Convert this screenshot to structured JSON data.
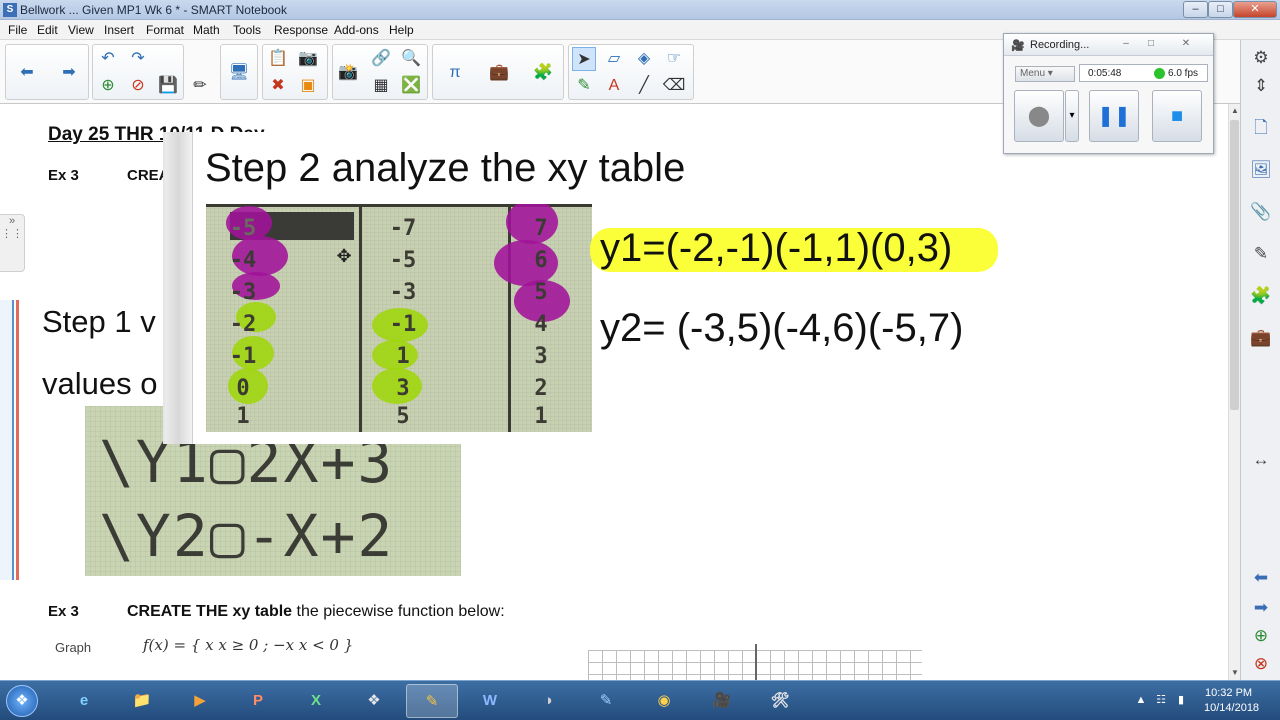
{
  "window": {
    "title": "Bellwork ... Given MP1 Wk 6 * - SMART Notebook",
    "minimize": "–",
    "maximize": "□",
    "close": "✕"
  },
  "menu": [
    "File",
    "Edit",
    "View",
    "Insert",
    "Format",
    "Math",
    "Tools",
    "Response",
    "Add-ons",
    "Help"
  ],
  "toolbar": {
    "icons": [
      "back-arrow-icon",
      "forward-arrow-icon",
      "undo-icon",
      "redo-icon",
      "add-page-icon",
      "delete-page-icon",
      "save-icon",
      "pen-icon",
      "screen-shade-icon",
      "paste-icon",
      "screen-capture-icon",
      "delete-icon",
      "table-icon",
      "object-icon",
      "pi-math-icon",
      "gallery-icon",
      "puzzle-icon",
      "select-icon",
      "fill-icon",
      "eraser-icon",
      "pens-icon",
      "text-icon",
      "line-icon",
      "magic-pen-icon"
    ]
  },
  "canvas": {
    "day_heading": "Day 25 THR 10/11   D Day",
    "ex3_label": "Ex 3",
    "ex3_create_prefix": "CREA",
    "step1_line1": "Step 1 v",
    "step1_line2": "values o",
    "calc_eq1": "\\Y1▢2X+3",
    "calc_eq2": "\\Y2▢-X+2",
    "step2_title": "Step 2 analyze the xy table",
    "y1_text": "y1=(-2,-1)(-1,1)(0,3)",
    "y2_text": "y2= (-3,5)(-4,6)(-5,7)",
    "ex3_bottom_label": "Ex 3",
    "ex3_bottom_bold": "CREATE THE  xy table",
    "ex3_bottom_rest": " the piecewise function below:",
    "graph_label": "Graph",
    "fx_text": "f(x) = { x   x ≥ 0 ; −x   x < 0 }"
  },
  "calc_table": {
    "x_col": [
      "-5",
      "-4",
      "-3",
      "-2",
      "-1",
      "0",
      "1"
    ],
    "y1_col": [
      "-7",
      "-5",
      "-3",
      "-1",
      "1",
      "3",
      "5"
    ],
    "y2_col": [
      "7",
      "6",
      "5",
      "4",
      "3",
      "2",
      "1"
    ],
    "highlight_purple": "#a0129a",
    "highlight_green": "#9ed60a"
  },
  "recorder": {
    "title": "Recording...",
    "menu_label": "Menu",
    "elapsed": "0:05:48",
    "fps": "6.0 fps",
    "status_color": "#2cc22c"
  },
  "taskbar": {
    "apps": [
      "ie-icon",
      "explorer-icon",
      "media-player-icon",
      "powerpoint-icon",
      "excel-icon",
      "lab-app-icon",
      "smart-notebook-icon",
      "word-icon",
      "eclipse-icon",
      "notes-icon",
      "chrome-icon",
      "recorder-icon",
      "tools-icon"
    ],
    "time": "10:32 PM",
    "date": "10/14/2018"
  }
}
